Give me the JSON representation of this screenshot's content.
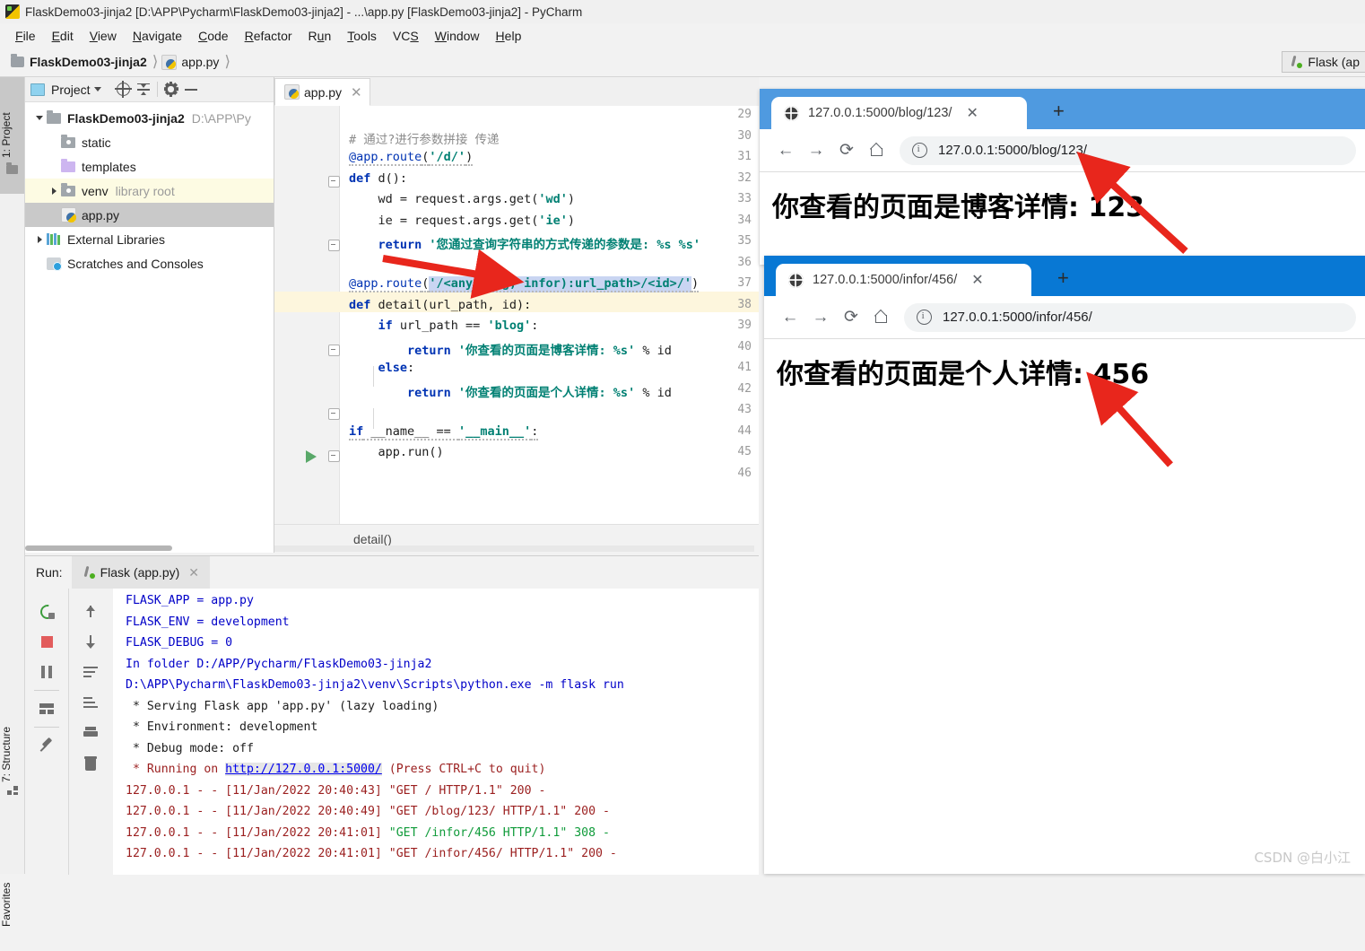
{
  "window": {
    "title": "FlaskDemo03-jinja2 [D:\\APP\\Pycharm\\FlaskDemo03-jinja2] - ...\\app.py [FlaskDemo03-jinja2] - PyCharm",
    "app_icon": "pycharm-icon"
  },
  "menu": {
    "items": [
      "File",
      "Edit",
      "View",
      "Navigate",
      "Code",
      "Refactor",
      "Run",
      "Tools",
      "VCS",
      "Window",
      "Help"
    ]
  },
  "breadcrumb": {
    "project": "FlaskDemo03-jinja2",
    "file": "app.py"
  },
  "run_widget": {
    "label": "Flask (ap"
  },
  "left_strip": {
    "project_tab": "1: Project",
    "structure_tab": "7: Structure",
    "favorites_tab": "Favorites"
  },
  "project_panel": {
    "title": "Project",
    "tree": [
      {
        "label": "FlaskDemo03-jinja2",
        "path": "D:\\APP\\Py",
        "icon": "folder-icon",
        "arrow": "down",
        "bold": true,
        "depth": 0
      },
      {
        "label": "static",
        "note": "",
        "icon": "source-folder-icon",
        "arrow": "none",
        "bold": false,
        "depth": 1
      },
      {
        "label": "templates",
        "note": "",
        "icon": "templates-folder-icon",
        "arrow": "none",
        "bold": false,
        "depth": 1
      },
      {
        "label": "venv",
        "note": "library root",
        "icon": "folder-icon",
        "arrow": "right",
        "bold": false,
        "depth": 1,
        "highlight": true
      },
      {
        "label": "app.py",
        "note": "",
        "icon": "python-file-icon",
        "arrow": "none",
        "bold": false,
        "depth": 1,
        "selected": true
      },
      {
        "label": "External Libraries",
        "note": "",
        "icon": "libraries-icon",
        "arrow": "right",
        "bold": false,
        "depth": 0
      },
      {
        "label": "Scratches and Consoles",
        "note": "",
        "icon": "scratches-icon",
        "arrow": "none",
        "bold": false,
        "depth": 0
      }
    ]
  },
  "editor": {
    "tab_label": "app.py",
    "breadcrumb_bottom": "detail()",
    "first_line_number": 29,
    "highlighted_line": 37,
    "lines": [
      {
        "n": 29,
        "tokens": []
      },
      {
        "n": 30,
        "tokens": [
          {
            "t": "# 通过?进行参数拼接 传递",
            "c": "cmt"
          }
        ]
      },
      {
        "n": 31,
        "tokens": [
          {
            "t": "@app.route",
            "c": "decn"
          },
          {
            "t": "(",
            "c": "pl"
          },
          {
            "t": "'/d/'",
            "c": "str"
          },
          {
            "t": ")",
            "c": "pl"
          }
        ]
      },
      {
        "n": 32,
        "tokens": [
          {
            "t": "def",
            "c": "kw"
          },
          {
            "t": " d():",
            "c": "pl"
          }
        ]
      },
      {
        "n": 33,
        "tokens": [
          {
            "t": "    wd = request.args.get(",
            "c": "pl"
          },
          {
            "t": "'wd'",
            "c": "str"
          },
          {
            "t": ")",
            "c": "pl"
          }
        ]
      },
      {
        "n": 34,
        "tokens": [
          {
            "t": "    ie = request.args.get(",
            "c": "pl"
          },
          {
            "t": "'ie'",
            "c": "str"
          },
          {
            "t": ")",
            "c": "pl"
          }
        ]
      },
      {
        "n": 35,
        "tokens": [
          {
            "t": "    return",
            "c": "kw"
          },
          {
            "t": " '您通过查询字符串的方式传递的参数是: %s %s'",
            "c": "str"
          }
        ]
      },
      {
        "n": 36,
        "tokens": []
      },
      {
        "n": 37,
        "tokens": [
          {
            "t": "@app.route",
            "c": "decn"
          },
          {
            "t": "(",
            "c": "pl"
          },
          {
            "t": "'/<any(blog, infor):url_path>/<id>/'",
            "c": "str"
          },
          {
            "t": ")",
            "c": "pl"
          }
        ]
      },
      {
        "n": 38,
        "tokens": [
          {
            "t": "def",
            "c": "kw"
          },
          {
            "t": " detail(url_path, id):",
            "c": "pl"
          }
        ]
      },
      {
        "n": 39,
        "tokens": [
          {
            "t": "    if",
            "c": "kw"
          },
          {
            "t": " url_path == ",
            "c": "pl"
          },
          {
            "t": "'blog'",
            "c": "str"
          },
          {
            "t": ":",
            "c": "pl"
          }
        ]
      },
      {
        "n": 40,
        "tokens": [
          {
            "t": "        return",
            "c": "kw"
          },
          {
            "t": " '你查看的页面是博客详情: %s'",
            "c": "str"
          },
          {
            "t": " % id",
            "c": "pl"
          }
        ]
      },
      {
        "n": 41,
        "tokens": [
          {
            "t": "    else",
            "c": "kw"
          },
          {
            "t": ":",
            "c": "pl"
          }
        ]
      },
      {
        "n": 42,
        "tokens": [
          {
            "t": "        return",
            "c": "kw"
          },
          {
            "t": " '你查看的页面是个人详情: %s'",
            "c": "str"
          },
          {
            "t": " % id",
            "c": "pl"
          }
        ]
      },
      {
        "n": 43,
        "tokens": []
      },
      {
        "n": 44,
        "tokens": [
          {
            "t": "if",
            "c": "kw"
          },
          {
            "t": " __name__ == ",
            "c": "pl"
          },
          {
            "t": "'__main__'",
            "c": "str"
          },
          {
            "t": ":",
            "c": "pl"
          }
        ]
      },
      {
        "n": 45,
        "tokens": [
          {
            "t": "    app.run()",
            "c": "pl"
          }
        ]
      },
      {
        "n": 46,
        "tokens": []
      }
    ]
  },
  "run_panel": {
    "label": "Run:",
    "tab_label": "Flask (app.py)",
    "console": [
      {
        "segments": [
          {
            "t": "FLASK_APP = app.py",
            "c": "c-blue"
          }
        ]
      },
      {
        "segments": [
          {
            "t": "FLASK_ENV = development",
            "c": "c-blue"
          }
        ]
      },
      {
        "segments": [
          {
            "t": "FLASK_DEBUG = 0",
            "c": "c-blue"
          }
        ]
      },
      {
        "segments": [
          {
            "t": "In folder D:/APP/Pycharm/FlaskDemo03-jinja2",
            "c": "c-blue"
          }
        ]
      },
      {
        "segments": [
          {
            "t": "D:\\APP\\Pycharm\\FlaskDemo03-jinja2\\venv\\Scripts\\python.exe -m flask run",
            "c": "c-blue"
          }
        ]
      },
      {
        "segments": [
          {
            "t": " * Serving Flask app 'app.py' (lazy loading)",
            "c": "c-dark"
          }
        ]
      },
      {
        "segments": [
          {
            "t": " * Environment: development",
            "c": "c-dark"
          }
        ]
      },
      {
        "segments": [
          {
            "t": " * Debug mode: off",
            "c": "c-dark"
          }
        ]
      },
      {
        "segments": [
          {
            "t": " * Running on ",
            "c": "c-red"
          },
          {
            "t": "http://127.0.0.1:5000/",
            "c": "c-link"
          },
          {
            "t": " (Press CTRL+C to quit)",
            "c": "c-red"
          }
        ]
      },
      {
        "segments": [
          {
            "t": "127.0.0.1 - - [11/Jan/2022 20:40:43] \"GET / HTTP/1.1\" 200 -",
            "c": "c-red"
          }
        ]
      },
      {
        "segments": [
          {
            "t": "127.0.0.1 - - [11/Jan/2022 20:40:49] \"GET /blog/123/ HTTP/1.1\" 200 -",
            "c": "c-red"
          }
        ]
      },
      {
        "segments": [
          {
            "t": "127.0.0.1 - - [11/Jan/2022 20:41:01] ",
            "c": "c-red"
          },
          {
            "t": "\"GET /infor/456 HTTP/1.1\" 308 -",
            "c": "c-green"
          }
        ]
      },
      {
        "segments": [
          {
            "t": "127.0.0.1 - - [11/Jan/2022 20:41:01] \"GET /infor/456/ HTTP/1.1\" 200 -",
            "c": "c-red"
          }
        ]
      }
    ]
  },
  "browsers": [
    {
      "tab_title": "127.0.0.1:5000/blog/123/",
      "url": "127.0.0.1:5000/blog/123/",
      "url_host": "127.0.0.1:5000",
      "url_path": "/blog/123/",
      "page_heading": "你查看的页面是博客详情: 123",
      "titlebar_color": "#4f9ae0",
      "new_tab_label": "+"
    },
    {
      "tab_title": "127.0.0.1:5000/infor/456/",
      "url": "127.0.0.1:5000/infor/456/",
      "url_host": "127.0.0.1:5000",
      "url_path": "/infor/456/",
      "page_heading": "你查看的页面是个人详情: 456",
      "titlebar_color": "#0878d4",
      "new_tab_label": "+"
    }
  ],
  "annotations": {
    "arrow_color": "#e8261c",
    "count": 3
  },
  "watermark": "CSDN @白小江"
}
